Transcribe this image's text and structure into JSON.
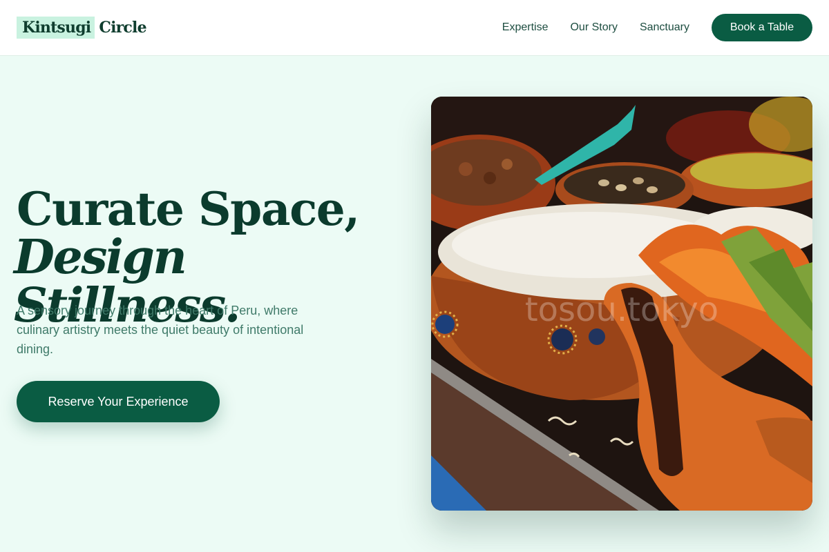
{
  "header": {
    "logo_highlight": "Kintsugi",
    "logo_rest": "Circle",
    "nav": [
      "Expertise",
      "Our Story",
      "Sanctuary"
    ],
    "cta_label": "Book a Table"
  },
  "hero": {
    "title_line1": "Curate Space,",
    "title_line2": "Design Stillness.",
    "subtitle": "A sensory journey through the heart of Peru, where culinary artistry meets the quiet beauty of intentional dining.",
    "cta_label": "Reserve Your Experience",
    "image_watermark": "tosou.tokyo"
  },
  "colors": {
    "brand": "#0a5c43",
    "background": "#ecfbf5",
    "logo_highlight": "#c9f2e0",
    "heading": "#0b3b2d",
    "body_text": "#3f7a69"
  }
}
